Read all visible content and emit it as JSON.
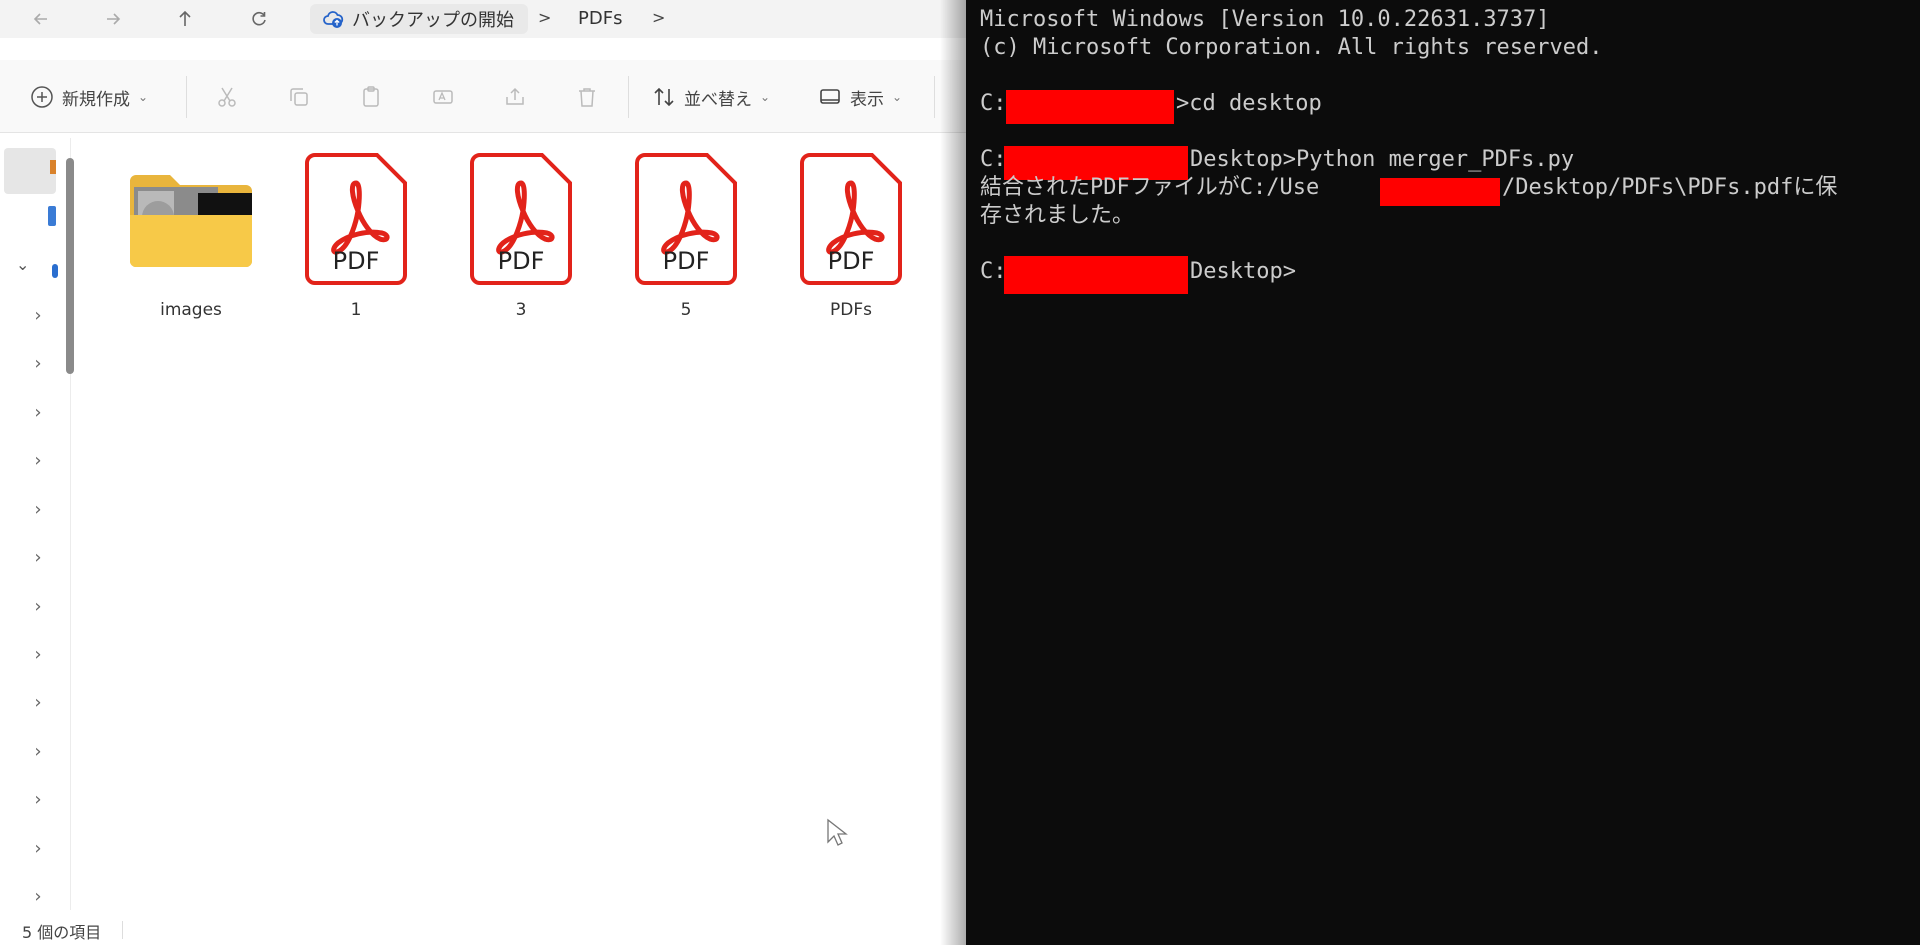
{
  "explorer": {
    "breadcrumb": {
      "root_label": "バックアップの開始",
      "current_label": "PDFs",
      "separator": ">"
    },
    "toolbar": {
      "new_label": "新規作成",
      "sort_label": "並べ替え",
      "view_label": "表示"
    },
    "files": [
      {
        "name": "images",
        "type": "folder"
      },
      {
        "name": "1",
        "type": "pdf"
      },
      {
        "name": "3",
        "type": "pdf"
      },
      {
        "name": "5",
        "type": "pdf"
      },
      {
        "name": "PDFs",
        "type": "pdf"
      }
    ],
    "pdf_icon_text": "PDF",
    "status": "5 個の項目",
    "colors": {
      "pdf_red": "#e2231a",
      "folder_yellow": "#f7c948"
    }
  },
  "terminal": {
    "lines": [
      "Microsoft Windows [Version 10.0.22631.3737]",
      "(c) Microsoft Corporation. All rights reserved.",
      "",
      "C:",
      ">cd desktop",
      "",
      "C:",
      "Desktop>Python merger_PDFs.py",
      "結合されたPDFファイルがC:/Use",
      "/Desktop/PDFs\\PDFs.pdfに保",
      "存されました。",
      "",
      "C:",
      "Desktop>"
    ],
    "colors": {
      "background": "#0c0c0c",
      "text": "#cccccc",
      "redaction": "#ff0000"
    }
  }
}
